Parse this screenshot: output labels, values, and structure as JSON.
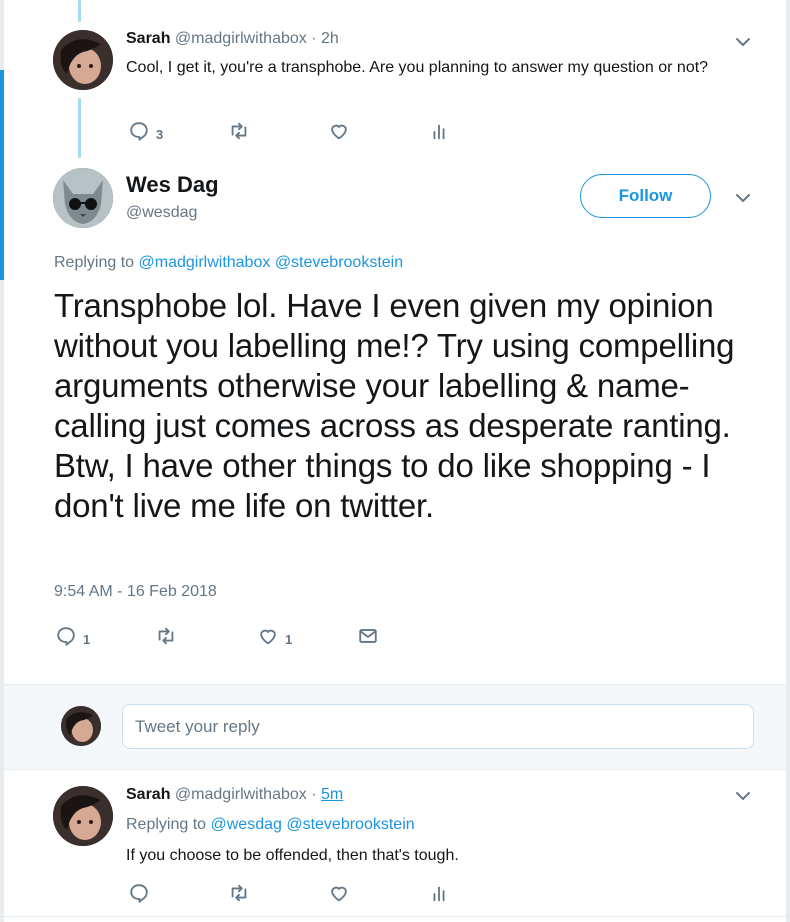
{
  "tweet_top": {
    "name": "Sarah",
    "handle": "@madgirlwithabox",
    "separator": "·",
    "time": "2h",
    "text": "Cool, I get it, you're a transphobe. Are you planning to answer my question or not?",
    "reply_count": "3"
  },
  "main_tweet": {
    "name": "Wes Dag",
    "handle": "@wesdag",
    "follow_label": "Follow",
    "replying_prefix": "Replying to",
    "mentions": [
      "@madgirlwithabox",
      "@stevebrookstein"
    ],
    "text": "Transphobe lol. Have I even given my opinion without you labelling me!? Try using compelling arguments otherwise your labelling & name-calling just comes across as desperate ranting. Btw, I have other things to do like shopping - I don't live me life on twitter.",
    "timestamp": "9:54 AM - 16 Feb 2018",
    "reply_count": "1",
    "like_count": "1"
  },
  "reply_box": {
    "placeholder": "Tweet your reply"
  },
  "tweet_bottom": {
    "name": "Sarah",
    "handle": "@madgirlwithabox",
    "separator": "·",
    "time": "5m",
    "replying_prefix": "Replying to",
    "mentions": [
      "@wesdag",
      "@stevebrookstein"
    ],
    "text": "If you choose to be offended, then that's tough."
  },
  "colors": {
    "accent": "#1b95e0",
    "muted": "#657786",
    "text": "#14171a"
  }
}
